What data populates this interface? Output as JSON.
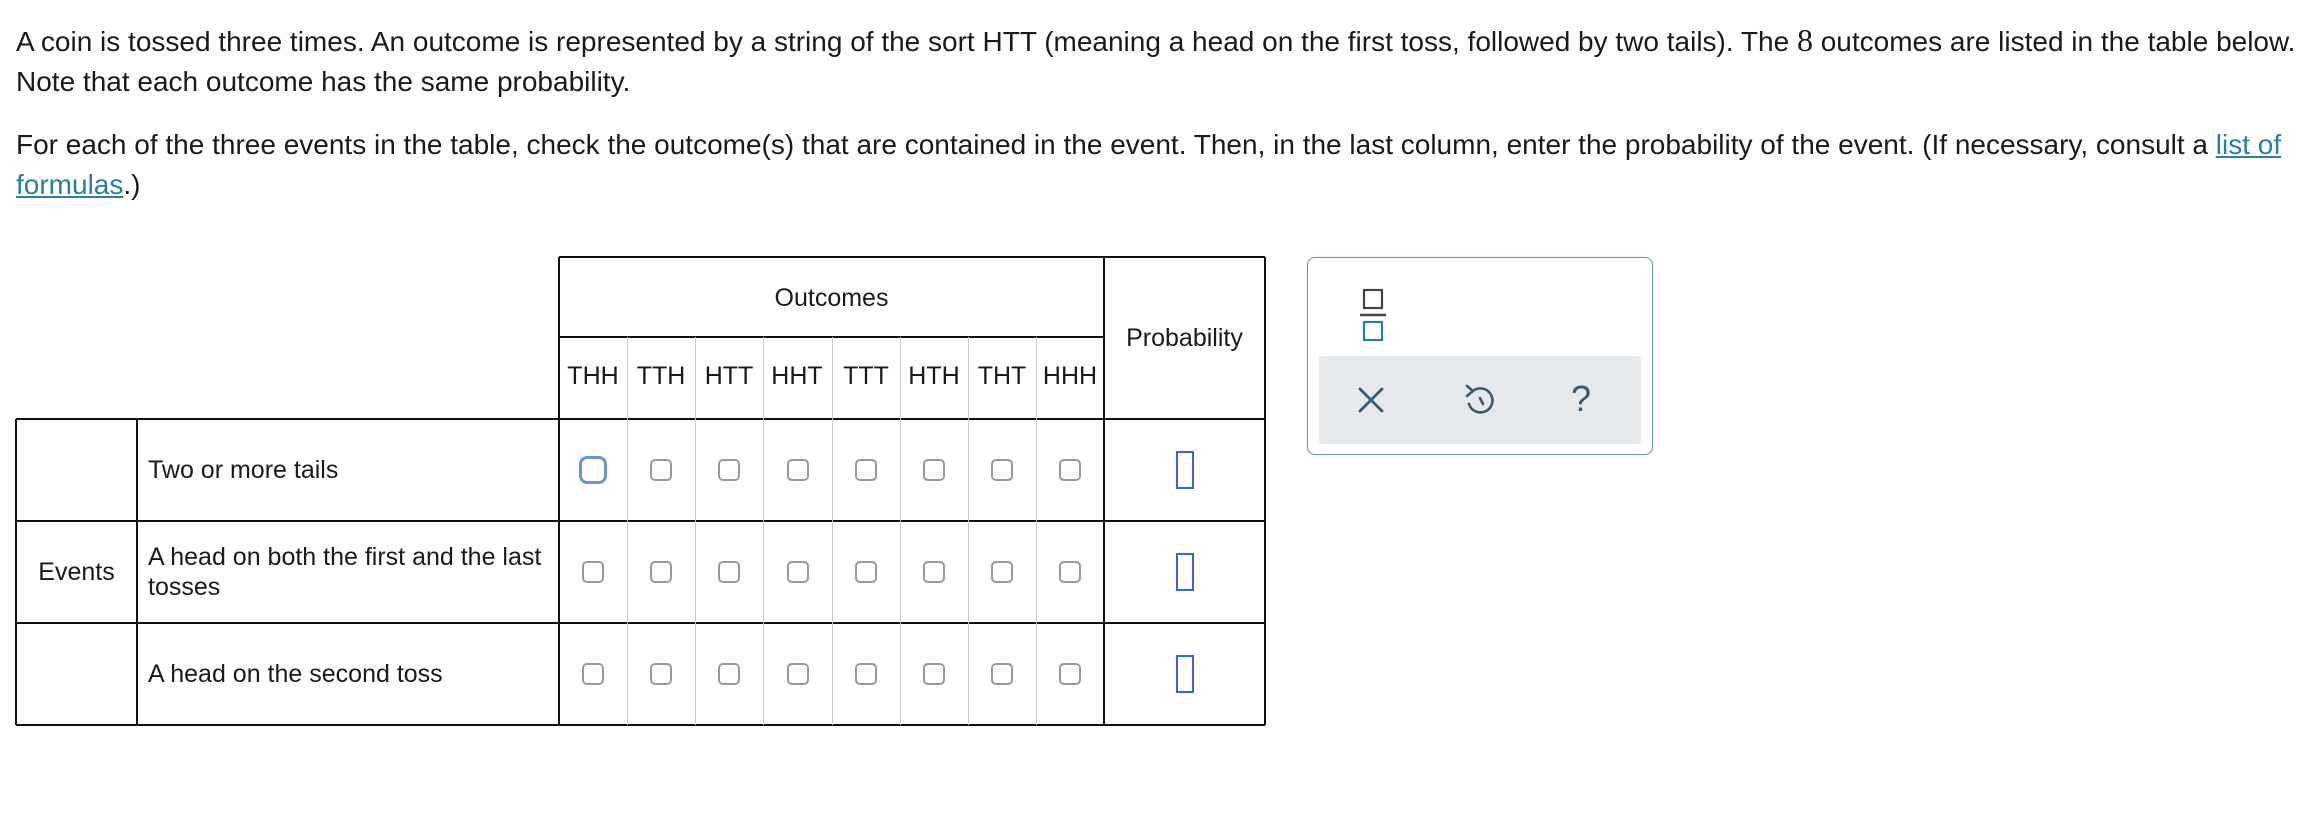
{
  "intro": {
    "text_before_num": "A coin is tossed three times. An outcome is represented by a string of the sort HTT (meaning a head on the first toss, followed by two tails). The ",
    "num": "8",
    "text_after_num": " outcomes are listed in the table below. Note that each outcome has the same probability."
  },
  "instructions": {
    "text_before_link": "For each of the three events in the table, check the outcome(s) that are contained in the event. Then, in the last column, enter the probability of the event. (If necessary, consult a ",
    "link_text": "list of formulas",
    "text_after_link": ".)"
  },
  "table": {
    "outcomes_header": "Outcomes",
    "probability_header": "Probability",
    "events_header": "Events",
    "outcomes": [
      "THH",
      "TTH",
      "HTT",
      "HHT",
      "TTT",
      "HTH",
      "THT",
      "HHH"
    ],
    "events": [
      {
        "label": "Two or more tails"
      },
      {
        "label": "A head on both the first and the last tosses"
      },
      {
        "label": "A head on the second toss"
      }
    ]
  },
  "toolbar": {
    "icons": [
      "fraction-icon",
      "close-icon",
      "undo-icon",
      "help-icon"
    ],
    "help_glyph": "?",
    "accent_color": "#2a7fa0",
    "input_border_color": "#3c63e6"
  }
}
